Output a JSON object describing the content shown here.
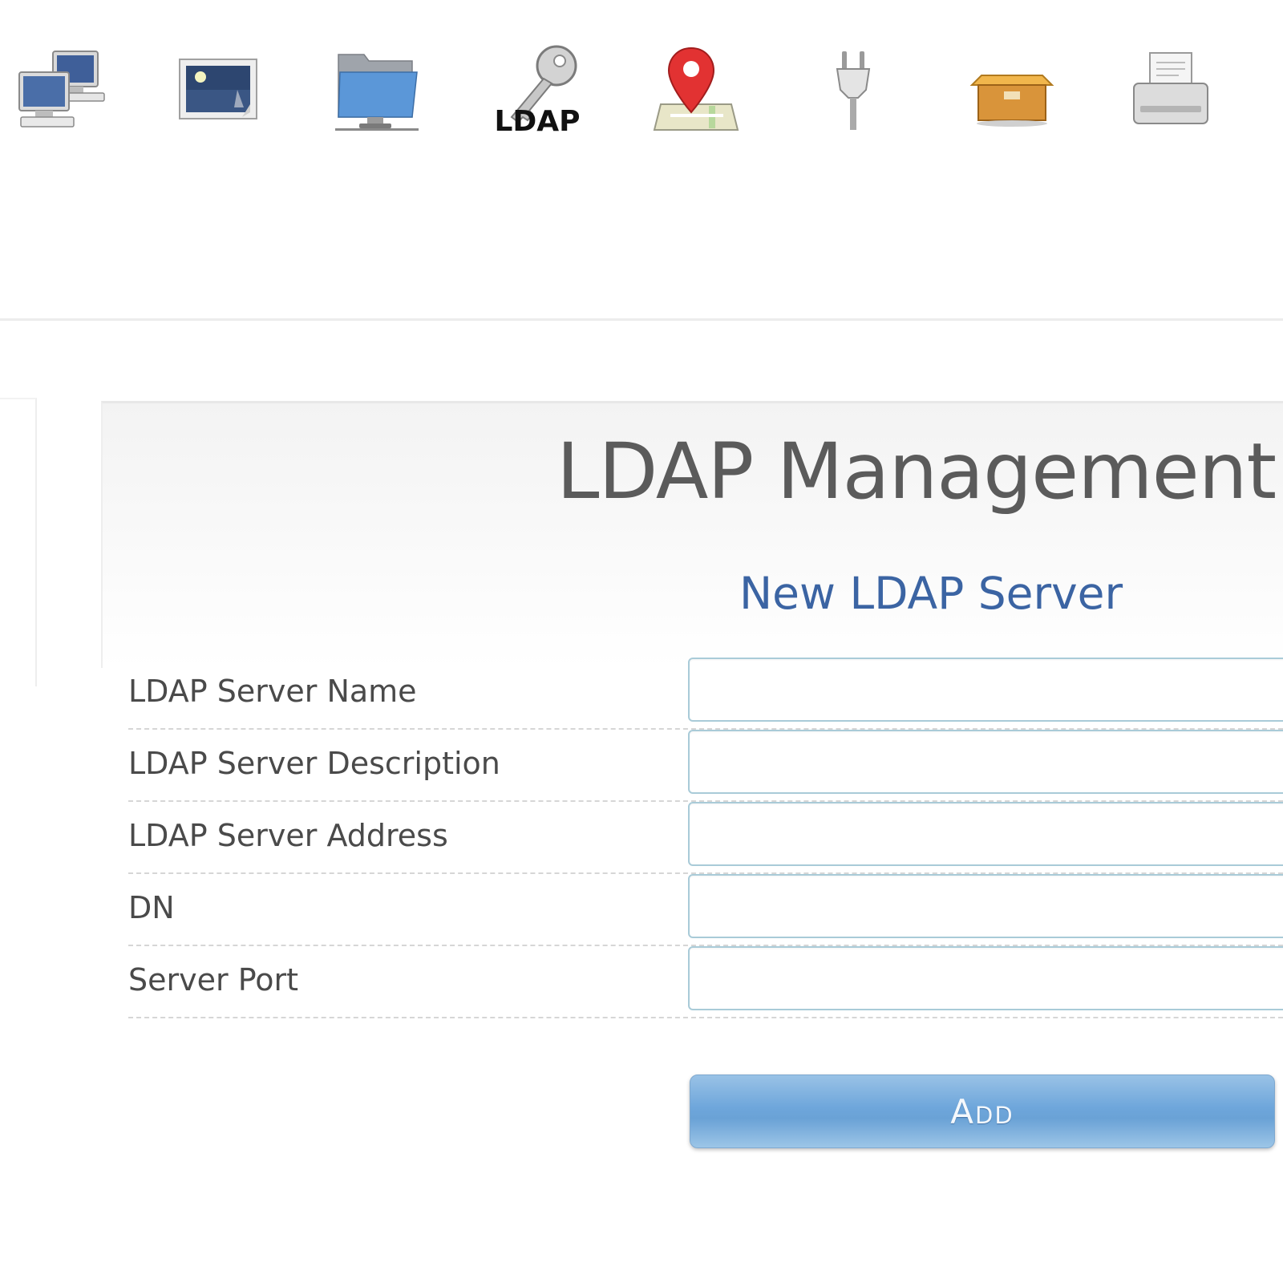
{
  "toolbar": {
    "items": [
      {
        "icon": "network-computers-icon"
      },
      {
        "icon": "image-icon"
      },
      {
        "icon": "network-folder-icon"
      },
      {
        "icon": "ldap-key-icon",
        "label": "LDAP"
      },
      {
        "icon": "map-pin-icon"
      },
      {
        "icon": "power-plug-icon"
      },
      {
        "icon": "package-box-icon"
      },
      {
        "icon": "printer-icon"
      }
    ]
  },
  "main": {
    "title": "LDAP Management",
    "section_title": "New LDAP Server"
  },
  "form": {
    "fields": [
      {
        "label": "LDAP Server Name",
        "value": "",
        "placeholder": ""
      },
      {
        "label": "LDAP Server Description",
        "value": "",
        "placeholder": ""
      },
      {
        "label": "LDAP Server Address",
        "value": "",
        "placeholder": ""
      },
      {
        "label": "DN",
        "value": "",
        "placeholder": ""
      },
      {
        "label": "Server Port",
        "value": "",
        "placeholder": ""
      }
    ],
    "submit_label": "Add"
  },
  "colors": {
    "title": "#5b5b5b",
    "section_title": "#3b64a3",
    "input_border": "#a9cbd8",
    "button": "#6ea6db"
  }
}
